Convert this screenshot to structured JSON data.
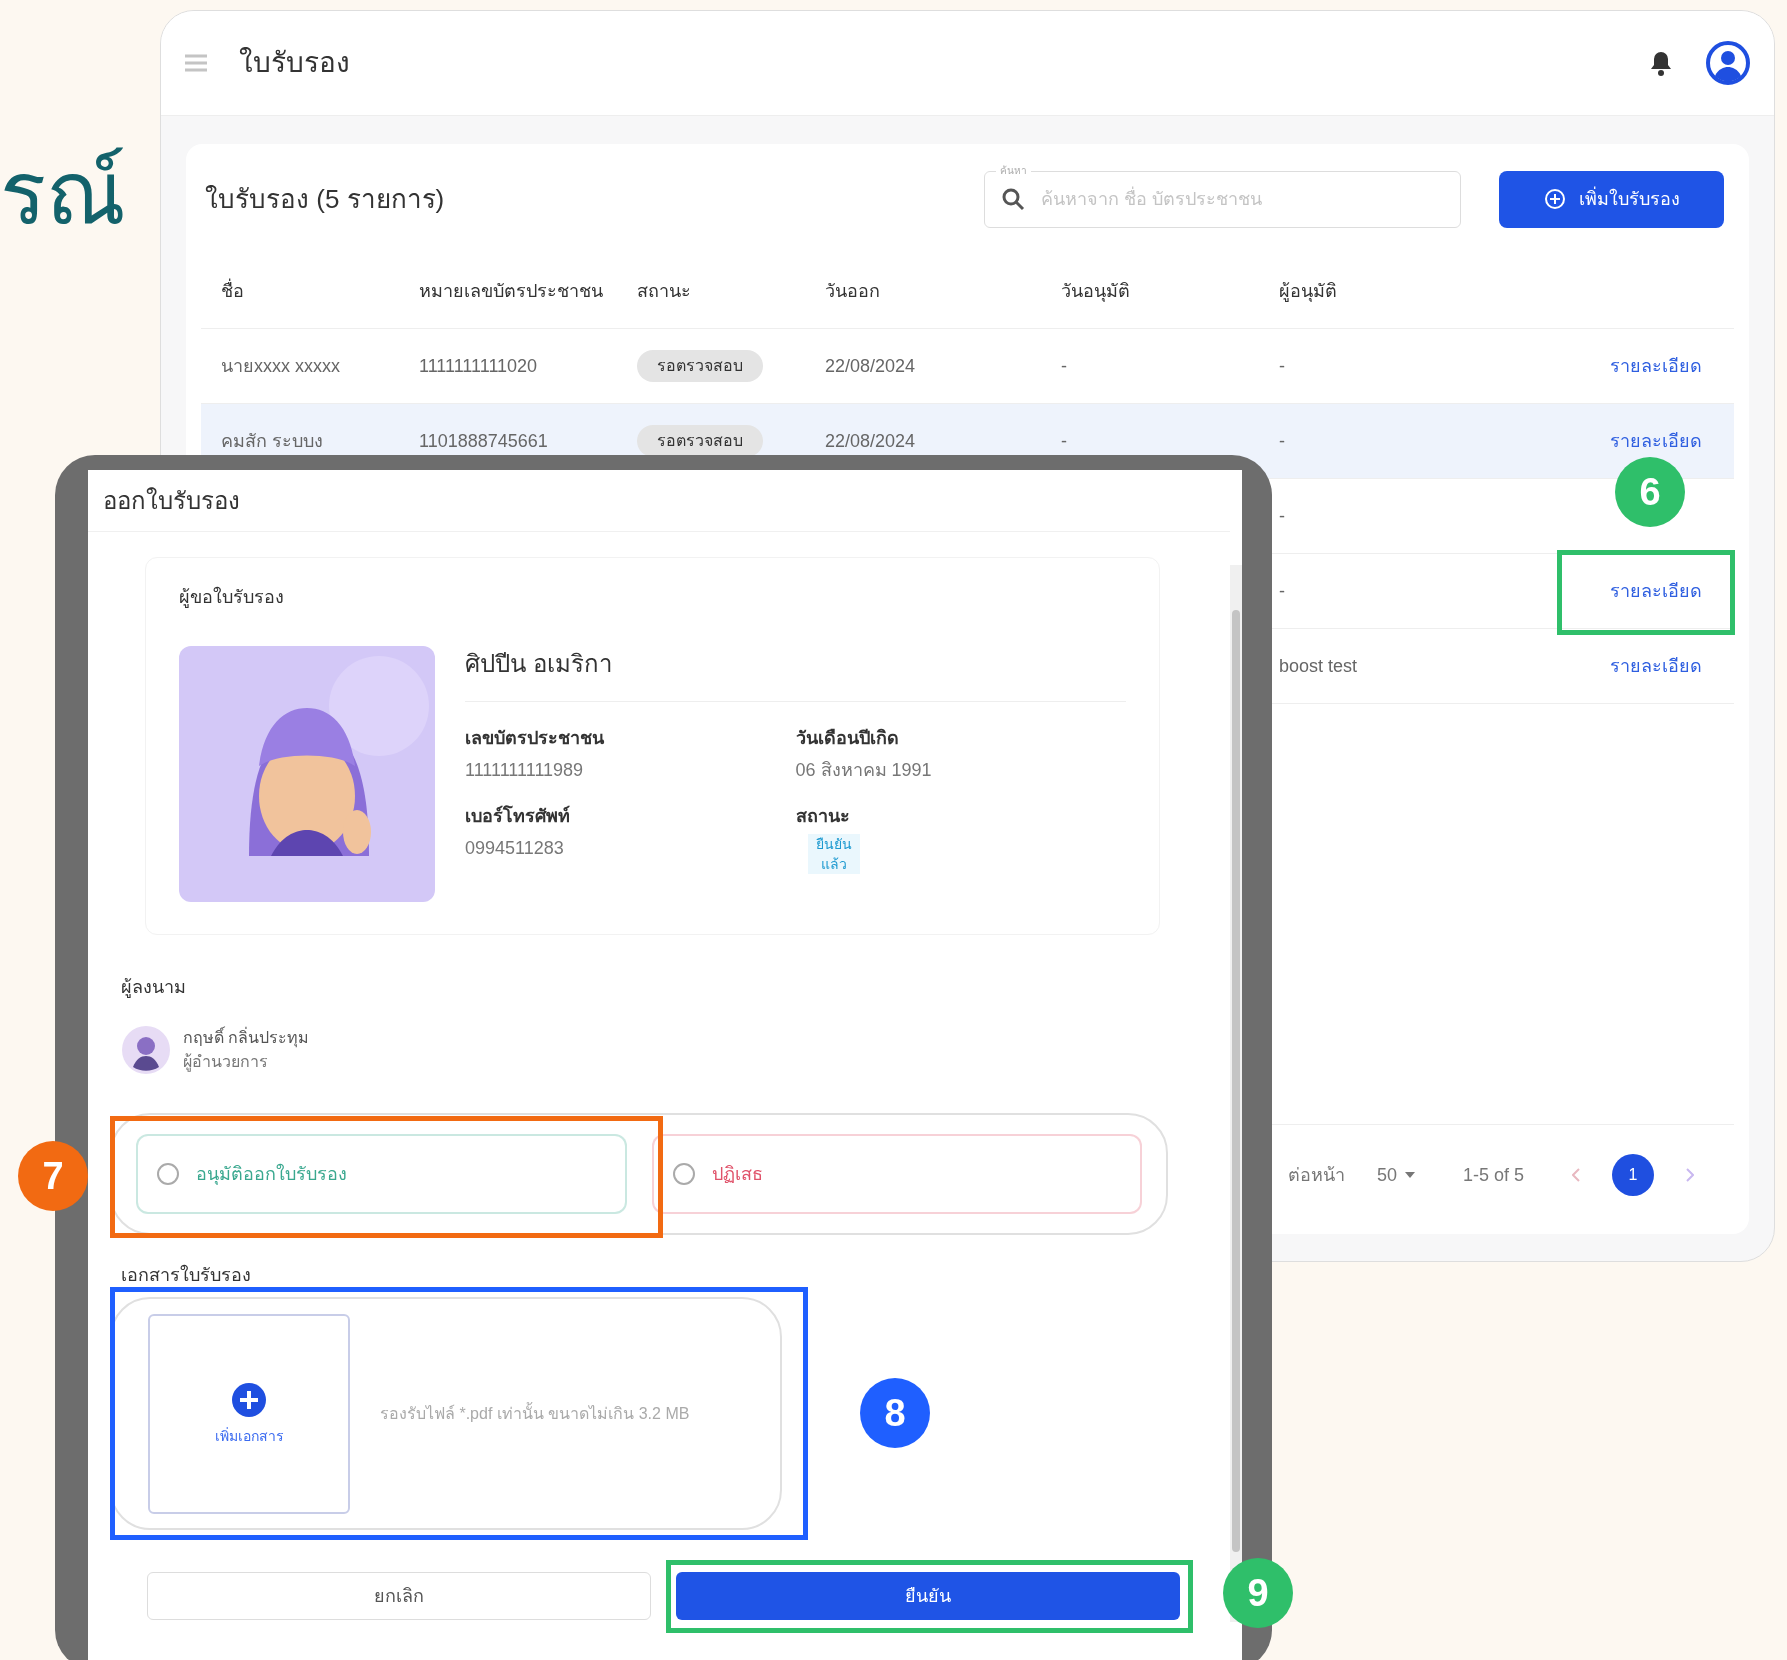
{
  "heading_fragment": "รณ์",
  "app": {
    "title": "ใบรับรอง"
  },
  "list": {
    "title": "ใบรับรอง (5 รายการ)",
    "search": {
      "label": "ค้นหา",
      "placeholder": "ค้นหาจาก ชื่อ บัตรประชาชน"
    },
    "add_button": "เพิ่มใบรับรอง",
    "columns": [
      "ชื่อ",
      "หมายเลขบัตรประชาชน",
      "สถานะ",
      "วันออก",
      "วันอนุมัติ",
      "ผู้อนุมัติ"
    ],
    "rows": [
      {
        "selected": false,
        "name": "นายxxxx xxxxx",
        "id_number": "1111111111020",
        "status": "รอตรวจสอบ",
        "issue_date": "22/08/2024",
        "approve_date": "-",
        "approver": "-",
        "action": "รายละเอียด"
      },
      {
        "selected": true,
        "name": "คมสัก ระบบง",
        "id_number": "1101888745661",
        "status": "รอตรวจสอบ",
        "issue_date": "22/08/2024",
        "approve_date": "-",
        "approver": "-",
        "action": "รายละเอียด"
      },
      {
        "selected": false,
        "approver": "-"
      },
      {
        "selected": false,
        "approver": "-",
        "action": "รายละเอียด"
      },
      {
        "selected": false,
        "approver": "boost test",
        "action": "รายละเอียด"
      }
    ],
    "pagination": {
      "rows_label": "ต่อหน้า",
      "rows_per_page": "50",
      "range": "1-5 of 5",
      "page": "1"
    }
  },
  "modal": {
    "title": "ออกใบรับรอง",
    "applicant_label": "ผู้ขอใบรับรอง",
    "name": "ศิปปีน อเมริกา",
    "fields": [
      {
        "label": "เลขบัตรประชาชน",
        "value": "1111111111989"
      },
      {
        "label": "วันเดือนปีเกิด",
        "value": "06 สิงหาคม 1991"
      },
      {
        "label": "เบอร์โทรศัพท์",
        "value": "0994511283"
      },
      {
        "label": "สถานะ",
        "value": "ยืนยัน\nแล้ว",
        "kind": "chip"
      }
    ],
    "signer_label": "ผู้ลงนาม",
    "signer": {
      "name": "กฤษดิ์ กลิ่นประทุม",
      "role": "ผู้อำนวยการ"
    },
    "decision": [
      {
        "label": "อนุมัติออกใบรับรอง",
        "selected": false,
        "color": "#3aa88f"
      },
      {
        "label": "ปฏิเสธ",
        "selected": false,
        "color": "#e0526a"
      }
    ],
    "document_label": "เอกสารใบรับรอง",
    "upload_button": "เพิ่มเอกสาร",
    "upload_hint": "รองรับไฟล์ *.pdf เท่านั้น ขนาดไม่เกิน 3.2 MB",
    "cancel": "ยกเลิก",
    "confirm": "ยืนยัน"
  },
  "annotations": [
    {
      "number": "6",
      "color": "#2fbf6a"
    },
    {
      "number": "7",
      "color": "#f26a12"
    },
    {
      "number": "8",
      "color": "#1f5fff"
    },
    {
      "number": "9",
      "color": "#2fbf6a"
    }
  ]
}
